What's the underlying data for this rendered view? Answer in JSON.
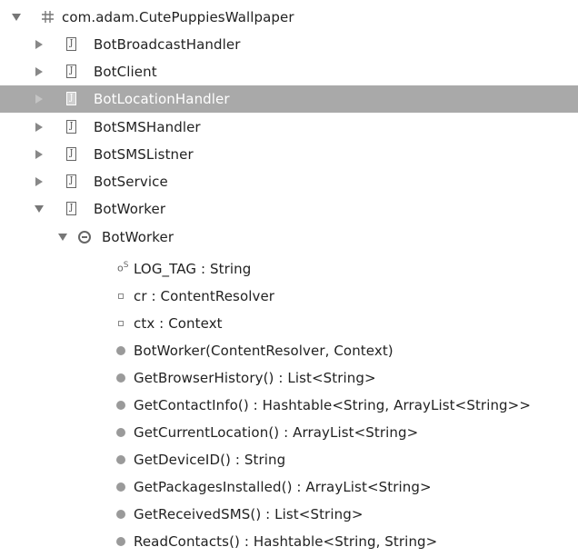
{
  "package": {
    "label": "com.adam.CutePuppiesWallpaper",
    "icon": "package-icon"
  },
  "files": [
    {
      "label": "BotBroadcastHandler",
      "icon": "java-file-icon",
      "state": "collapsed"
    },
    {
      "label": "BotClient",
      "icon": "java-file-icon",
      "state": "collapsed"
    },
    {
      "label": "BotLocationHandler",
      "icon": "java-file-icon",
      "state": "collapsed",
      "selected": true
    },
    {
      "label": "BotSMSHandler",
      "icon": "java-file-icon",
      "state": "collapsed"
    },
    {
      "label": "BotSMSListner",
      "icon": "java-file-icon",
      "state": "collapsed"
    },
    {
      "label": "BotService",
      "icon": "java-file-icon",
      "state": "collapsed"
    },
    {
      "label": "BotWorker",
      "icon": "java-file-icon",
      "state": "expanded"
    }
  ],
  "class_node": {
    "label": "BotWorker",
    "icon": "class-icon",
    "state": "expanded"
  },
  "members": [
    {
      "label": "LOG_TAG : String",
      "icon": "static-field-icon",
      "icon_text": "S"
    },
    {
      "label": "cr : ContentResolver",
      "icon": "field-icon"
    },
    {
      "label": "ctx : Context",
      "icon": "field-icon"
    },
    {
      "label": "BotWorker(ContentResolver, Context)",
      "icon": "method-icon"
    },
    {
      "label": "GetBrowserHistory() : List<String>",
      "icon": "method-icon"
    },
    {
      "label": "GetContactInfo() : Hashtable<String, ArrayList<String>>",
      "icon": "method-icon"
    },
    {
      "label": "GetCurrentLocation() : ArrayList<String>",
      "icon": "method-icon"
    },
    {
      "label": "GetDeviceID() : String",
      "icon": "method-icon"
    },
    {
      "label": "GetPackagesInstalled() : ArrayList<String>",
      "icon": "method-icon"
    },
    {
      "label": "GetReceivedSMS() : List<String>",
      "icon": "method-icon"
    },
    {
      "label": "ReadContacts() : Hashtable<String, String>",
      "icon": "method-icon"
    }
  ],
  "colors": {
    "selection": "#a9a9a9",
    "method_dot": "#9a9a9a"
  }
}
